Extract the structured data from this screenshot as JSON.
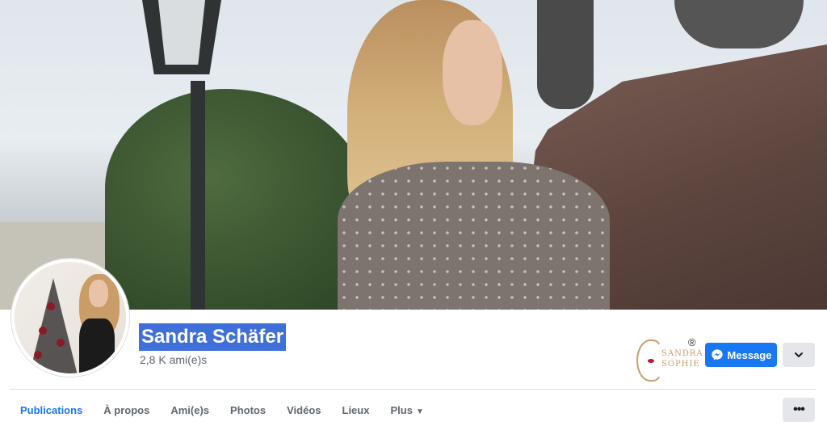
{
  "profile": {
    "name": "Sandra Schäfer",
    "friends": "2,8 K ami(e)s"
  },
  "brand_logo": {
    "line1": "SANDRA",
    "line2": "SOPHIE",
    "registered": "®"
  },
  "actions": {
    "message_label": "Message",
    "message_icon": "messenger-icon",
    "dropdown_icon": "chevron-down-icon",
    "more_icon": "ellipsis-icon"
  },
  "tabs": [
    {
      "label": "Publications",
      "active": true
    },
    {
      "label": "À propos"
    },
    {
      "label": "Ami(e)s"
    },
    {
      "label": "Photos"
    },
    {
      "label": "Vidéos"
    },
    {
      "label": "Lieux"
    },
    {
      "label": "Plus",
      "icon": "caret-down-icon"
    }
  ],
  "more_button_label": "•••",
  "colors": {
    "accent": "#1877f2",
    "selection": "#3f6fd8",
    "secondary_button": "#e4e6eb",
    "muted_text": "#606770"
  }
}
